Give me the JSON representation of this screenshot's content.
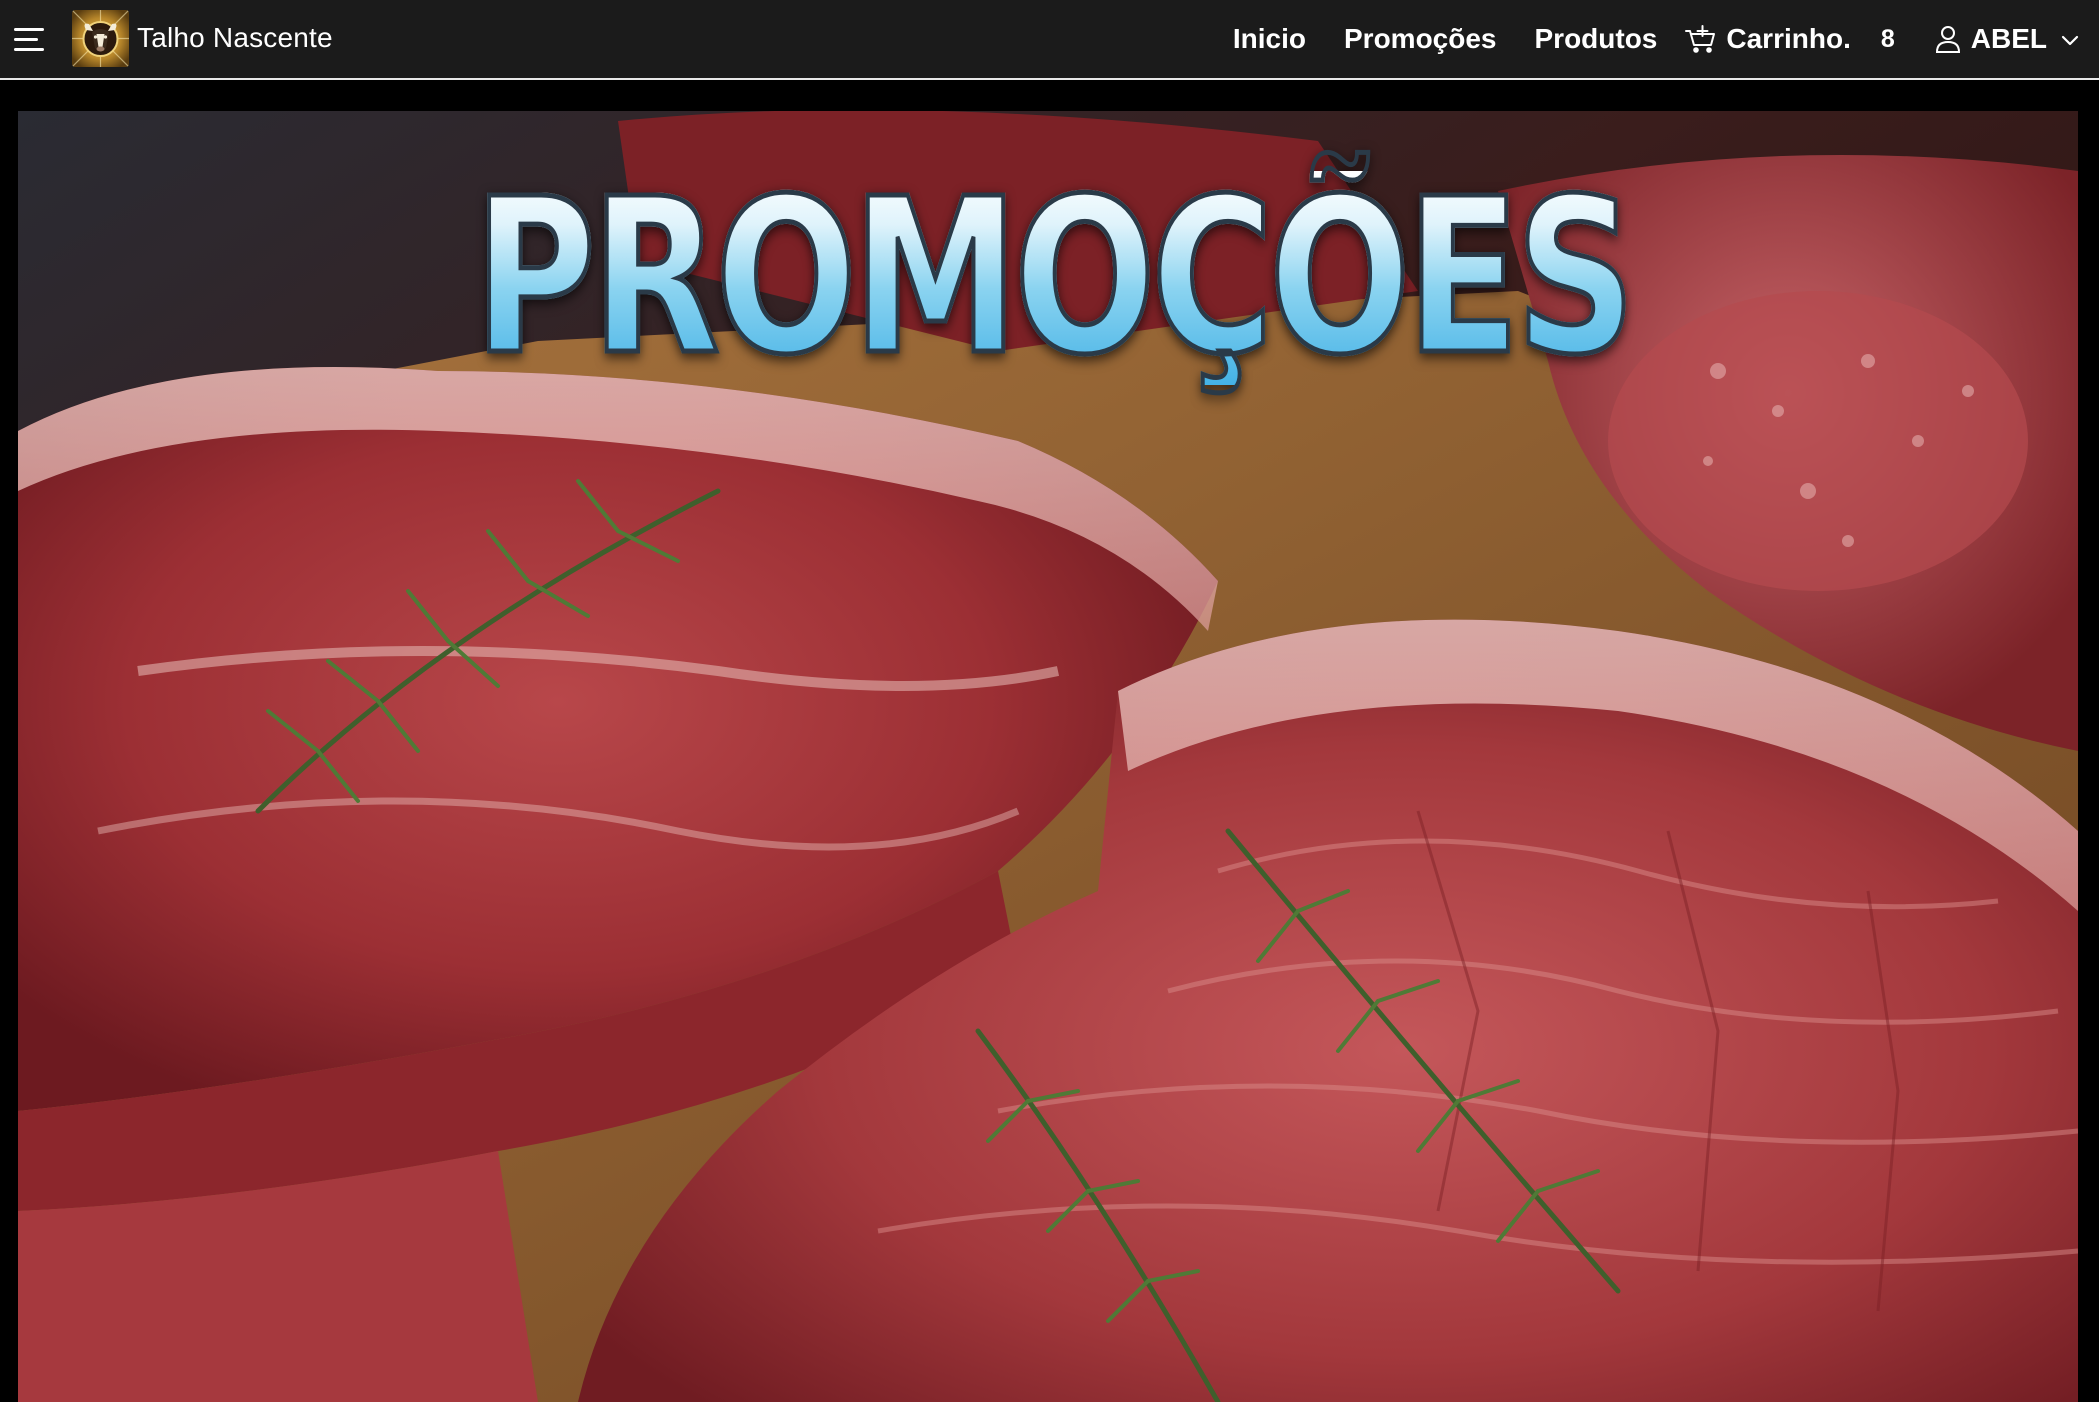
{
  "navbar": {
    "brand_name": "Talho Nascente",
    "links": {
      "home": "Inicio",
      "promotions": "Promoções",
      "products": "Produtos"
    },
    "cart": {
      "label": "Carrinho.",
      "count": "8"
    },
    "user": {
      "name": "ABEL"
    }
  },
  "banner": {
    "title": "PROMOÇÕES"
  },
  "colors": {
    "navbar_bg": "#1b1b1b",
    "navbar_text": "#ffffff",
    "page_bg": "#000000",
    "title_fill": "#6ccaf0",
    "title_outline": "#2a3a48"
  },
  "icons": {
    "menu": "hamburger-menu-icon",
    "logo": "butcher-bull-logo",
    "cart": "shopping-cart-icon",
    "user": "user-icon",
    "dropdown": "chevron-down-icon"
  }
}
